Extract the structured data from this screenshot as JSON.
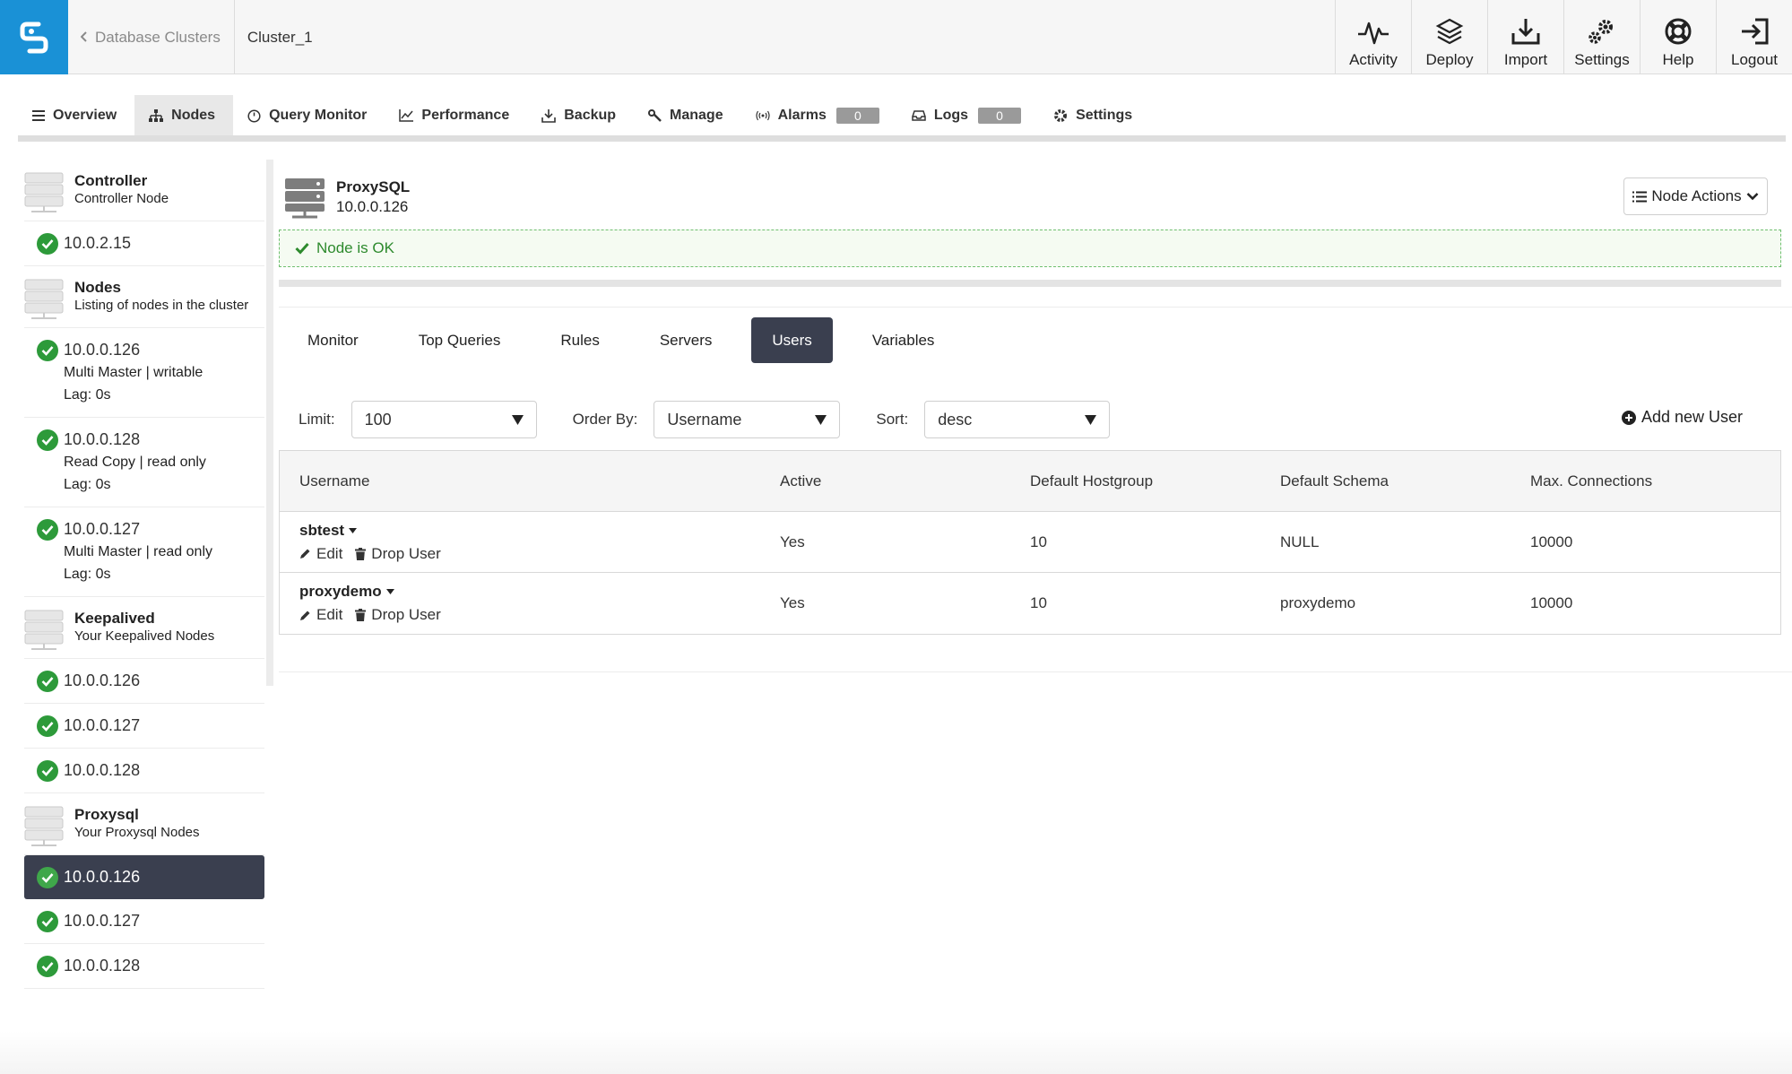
{
  "breadcrumb": {
    "back_label": "Database Clusters",
    "current": "Cluster_1"
  },
  "top_actions": [
    {
      "label": "Activity",
      "icon": "activity-icon"
    },
    {
      "label": "Deploy",
      "icon": "deploy-icon"
    },
    {
      "label": "Import",
      "icon": "import-icon"
    },
    {
      "label": "Settings",
      "icon": "gears-icon"
    },
    {
      "label": "Help",
      "icon": "lifebuoy-icon"
    },
    {
      "label": "Logout",
      "icon": "logout-icon"
    }
  ],
  "main_tabs": {
    "overview": "Overview",
    "nodes": "Nodes",
    "query_monitor": "Query Monitor",
    "performance": "Performance",
    "backup": "Backup",
    "manage": "Manage",
    "alarms": "Alarms",
    "alarms_count": "0",
    "logs": "Logs",
    "logs_count": "0",
    "settings": "Settings"
  },
  "sidebar": {
    "controller": {
      "title": "Controller",
      "subtitle": "Controller Node",
      "ip": "10.0.2.15"
    },
    "nodes": {
      "title": "Nodes",
      "subtitle": "Listing of nodes in the cluster",
      "items": [
        {
          "ip": "10.0.0.126",
          "role": "Multi Master | writable",
          "lag": "Lag: 0s"
        },
        {
          "ip": "10.0.0.128",
          "role": "Read Copy | read only",
          "lag": "Lag: 0s"
        },
        {
          "ip": "10.0.0.127",
          "role": "Multi Master | read only",
          "lag": "Lag: 0s"
        }
      ]
    },
    "keepalived": {
      "title": "Keepalived",
      "subtitle": "Your Keepalived Nodes",
      "items": [
        "10.0.0.126",
        "10.0.0.127",
        "10.0.0.128"
      ]
    },
    "proxysql": {
      "title": "Proxysql",
      "subtitle": "Your Proxysql Nodes",
      "items": [
        "10.0.0.126",
        "10.0.0.127",
        "10.0.0.128"
      ],
      "selected": "10.0.0.126"
    }
  },
  "node": {
    "name": "ProxySQL",
    "ip": "10.0.0.126",
    "actions_label": "Node Actions",
    "status": "Node is OK"
  },
  "sub_tabs": {
    "monitor": "Monitor",
    "top_queries": "Top Queries",
    "rules": "Rules",
    "servers": "Servers",
    "users": "Users",
    "variables": "Variables",
    "active": "Users"
  },
  "filters": {
    "limit_label": "Limit:",
    "limit_value": "100",
    "order_label": "Order By:",
    "order_value": "Username",
    "sort_label": "Sort:",
    "sort_value": "desc",
    "add_user": "Add new User"
  },
  "table": {
    "headers": [
      "Username",
      "Active",
      "Default Hostgroup",
      "Default Schema",
      "Max. Connections"
    ],
    "edit_label": "Edit",
    "drop_label": "Drop User",
    "rows": [
      {
        "username": "sbtest",
        "active": "Yes",
        "hostgroup": "10",
        "schema": "NULL",
        "max_conn": "10000"
      },
      {
        "username": "proxydemo",
        "active": "Yes",
        "hostgroup": "10",
        "schema": "proxydemo",
        "max_conn": "10000"
      }
    ]
  },
  "colors": {
    "brand": "#1a91d6",
    "dark": "#3a3f4f",
    "ok_green": "#2d9a3a"
  }
}
